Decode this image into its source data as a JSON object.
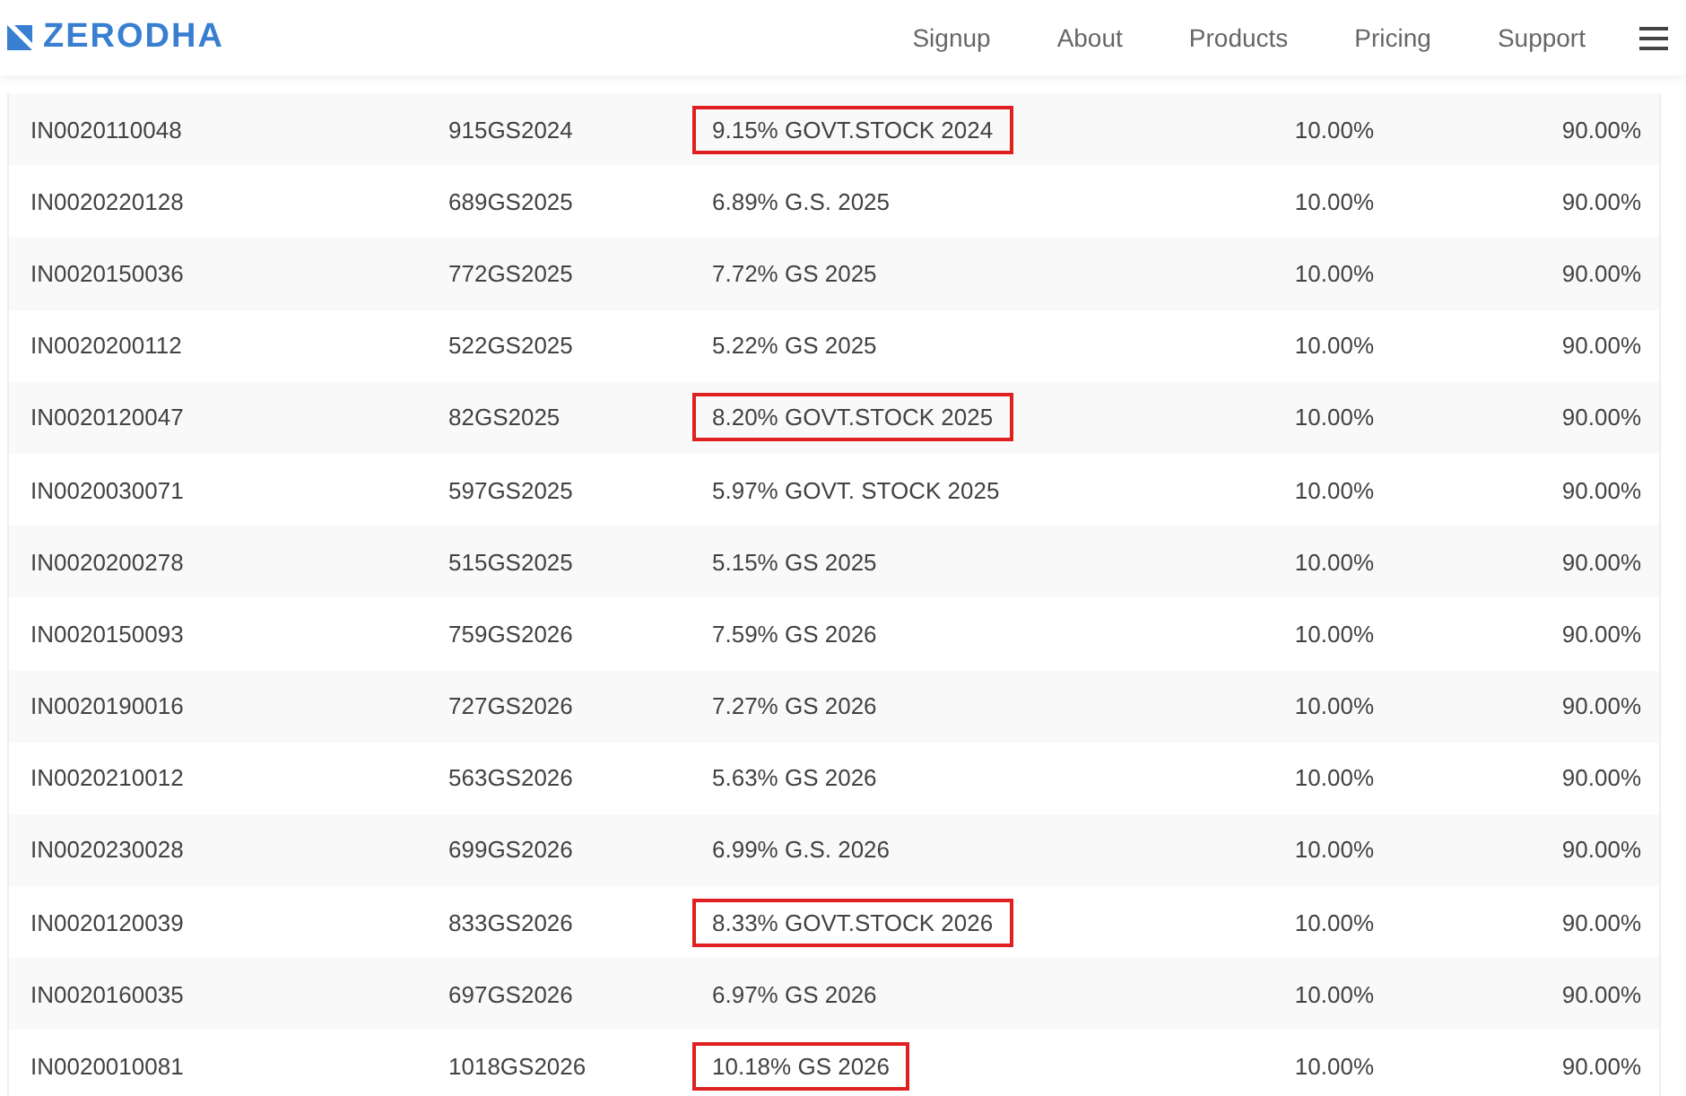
{
  "header": {
    "logo": "ZERODHA",
    "nav": [
      {
        "label": "Signup"
      },
      {
        "label": "About"
      },
      {
        "label": "Products"
      },
      {
        "label": "Pricing"
      },
      {
        "label": "Support"
      }
    ]
  },
  "table": {
    "rows": [
      {
        "isin": "IN0020110048",
        "symbol": "915GS2024",
        "name": "9.15% GOVT.STOCK 2024",
        "highlighted": true,
        "col4": "10.00%",
        "col5": "90.00%"
      },
      {
        "isin": "IN0020220128",
        "symbol": "689GS2025",
        "name": "6.89% G.S. 2025",
        "highlighted": false,
        "col4": "10.00%",
        "col5": "90.00%"
      },
      {
        "isin": "IN0020150036",
        "symbol": "772GS2025",
        "name": "7.72% GS 2025",
        "highlighted": false,
        "col4": "10.00%",
        "col5": "90.00%"
      },
      {
        "isin": "IN0020200112",
        "symbol": "522GS2025",
        "name": "5.22% GS 2025",
        "highlighted": false,
        "col4": "10.00%",
        "col5": "90.00%"
      },
      {
        "isin": "IN0020120047",
        "symbol": "82GS2025",
        "name": "8.20% GOVT.STOCK 2025",
        "highlighted": true,
        "col4": "10.00%",
        "col5": "90.00%"
      },
      {
        "isin": "IN0020030071",
        "symbol": "597GS2025",
        "name": "5.97% GOVT. STOCK 2025",
        "highlighted": false,
        "col4": "10.00%",
        "col5": "90.00%"
      },
      {
        "isin": "IN0020200278",
        "symbol": "515GS2025",
        "name": "5.15% GS 2025",
        "highlighted": false,
        "col4": "10.00%",
        "col5": "90.00%"
      },
      {
        "isin": "IN0020150093",
        "symbol": "759GS2026",
        "name": "7.59% GS 2026",
        "highlighted": false,
        "col4": "10.00%",
        "col5": "90.00%"
      },
      {
        "isin": "IN0020190016",
        "symbol": "727GS2026",
        "name": "7.27% GS 2026",
        "highlighted": false,
        "col4": "10.00%",
        "col5": "90.00%"
      },
      {
        "isin": "IN0020210012",
        "symbol": "563GS2026",
        "name": "5.63% GS 2026",
        "highlighted": false,
        "col4": "10.00%",
        "col5": "90.00%"
      },
      {
        "isin": "IN0020230028",
        "symbol": "699GS2026",
        "name": "6.99% G.S. 2026",
        "highlighted": false,
        "col4": "10.00%",
        "col5": "90.00%"
      },
      {
        "isin": "IN0020120039",
        "symbol": "833GS2026",
        "name": "8.33% GOVT.STOCK 2026",
        "highlighted": true,
        "col4": "10.00%",
        "col5": "90.00%"
      },
      {
        "isin": "IN0020160035",
        "symbol": "697GS2026",
        "name": "6.97% GS 2026",
        "highlighted": false,
        "col4": "10.00%",
        "col5": "90.00%"
      },
      {
        "isin": "IN0020010081",
        "symbol": "1018GS2026",
        "name": "10.18% GS 2026",
        "highlighted": true,
        "col4": "10.00%",
        "col5": "90.00%"
      }
    ]
  }
}
